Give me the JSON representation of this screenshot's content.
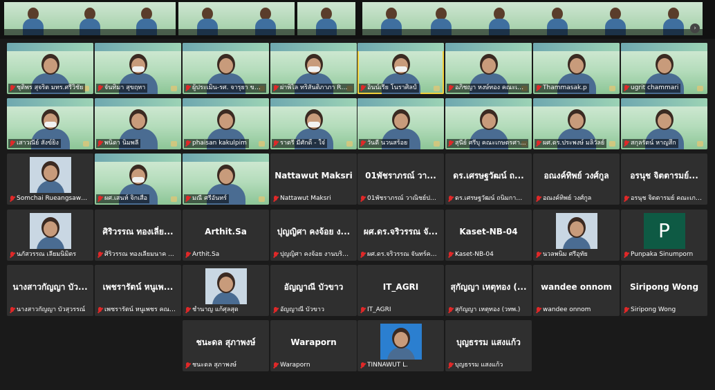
{
  "strip": {
    "thumbs": [
      "",
      "",
      "",
      "",
      "",
      "",
      "",
      "",
      "",
      "",
      "",
      "",
      "",
      "",
      "",
      "",
      "",
      "",
      "",
      "",
      "",
      "",
      "",
      ""
    ],
    "next_icon": "›"
  },
  "tiles": [
    {
      "name": "ชุติพร สุจริต มทร.ศรีวิชัย",
      "video": true,
      "mask": false
    },
    {
      "name": "จันทิมา สุขฤทา",
      "video": true,
      "mask": true
    },
    {
      "name": "ผู้ประเมิน-รศ. จารุยา ขอพลอ...",
      "video": true,
      "mask": false
    },
    {
      "name": "ผ่าพิไล ทริสันติภาภา RUTS",
      "video": true,
      "mask": true
    },
    {
      "name": "อินน์เรีย โนราศิลป์",
      "video": true,
      "mask": true,
      "active": true
    },
    {
      "name": "อภิชญา หงษ์ทอง คณะเก...",
      "video": true,
      "mask": false
    },
    {
      "name": "Thammasak.p",
      "video": true,
      "mask": false
    },
    {
      "name": "ugrit chammari",
      "video": true,
      "mask": false
    },
    {
      "name": "เสาวณีย์ สังข์ยิ่ง",
      "video": true,
      "mask": true
    },
    {
      "name": "พนิดา นิ่มพลี",
      "video": true,
      "mask": false
    },
    {
      "name": "phaisan kakulpim",
      "video": true,
      "mask": false
    },
    {
      "name": "ราตรี มีศักดิ์ - ใจ๋",
      "video": true,
      "mask": true
    },
    {
      "name": "วันดี นวนสร้อย",
      "video": true,
      "mask": false
    },
    {
      "name": "สุนีย์ ศรีบุ คณะเกษตรศา...",
      "video": true,
      "mask": false
    },
    {
      "name": "ผศ.ดร.ประพงษ์ มลิวัลย์",
      "video": true,
      "mask": false
    },
    {
      "name": "สกุลรัตน์ หาญสึก",
      "video": true,
      "mask": false
    },
    {
      "name": "Somchai Rueangsawa...",
      "photo": true
    },
    {
      "name": "ผศ.เสนห์ จิกเสือ",
      "video": true,
      "mask": true
    },
    {
      "name": "มณี ศรีอันทร์",
      "video": true,
      "mask": false
    },
    {
      "name": "Nattawut Maksri",
      "center": "Nattawut Maksri"
    },
    {
      "name": "01พัชราภรณ์ วาณิชย์ปก...",
      "center": "01พัชราภรณ์ วา..."
    },
    {
      "name": "ดร.เศรษฐวัฒน์ ถนิมกาญ...",
      "center": "ดร.เศรษฐวัฒน์ ถ..."
    },
    {
      "name": "อณงค์ทิพย์ วงศ์กูล",
      "center": "อณงค์ทิพย์ วงศ์กูล"
    },
    {
      "name": "อรนุช จิตตารมย์ คณะเกษ...",
      "center": "อรนุช จิตตารมย์..."
    },
    {
      "name": "นภัสวรรณ เลียมนิมิตร",
      "photo": true
    },
    {
      "name": "ศิริวรรณ ทองเลี่ยมนาค ...",
      "center": "ศิริวรรณ ทองเลี่ย..."
    },
    {
      "name": "Arthit.Sa",
      "center": "Arthit.Sa"
    },
    {
      "name": "ปุญญิศา คงจ้อย งานบริก...",
      "center": "ปุญญิศา คงจ้อย ง..."
    },
    {
      "name": "ผศ.ดร.จริวรรณ จันทร์คง ...",
      "center": "ผศ.ดร.จริวรรณ จั..."
    },
    {
      "name": "Kaset-NB-04",
      "center": "Kaset-NB-04"
    },
    {
      "name": "นวลพนิม ศรีอุทัย",
      "photo": true
    },
    {
      "name": "Punpaka Sinumporn",
      "letter": "P"
    },
    {
      "name": "นางสาวกัญญา บัวสุวรรณ์",
      "center": "นางสาวกัญญา บัว..."
    },
    {
      "name": "เพชรารัตน์ หนูเพชร คณะ...",
      "center": "เพชรารัตน์ หนูเพ..."
    },
    {
      "name": "ชำนาญ แก้ศุลสุด",
      "photo": true
    },
    {
      "name": "อัญญาณี บัวขาว",
      "center": "อัญญาณี บัวขาว"
    },
    {
      "name": "IT_AGRI",
      "center": "IT_AGRI"
    },
    {
      "name": "สุกัญญา เหตุทอง (วทพ.)",
      "center": "สุกัญญา เหตุทอง (..."
    },
    {
      "name": "wandee onnom",
      "center": "wandee onnom"
    },
    {
      "name": "Siripong Wong",
      "center": "Siripong Wong"
    },
    {
      "name": "ชนะดล สุภาพงษ์",
      "center": "ชนะดล สุภาพงษ์"
    },
    {
      "name": "Waraporn",
      "center": "Waraporn"
    },
    {
      "name": "TINNAWUT L.",
      "photo": true,
      "blue": true
    },
    {
      "name": "บุญธรรม แสงแก้ว",
      "center": "บุญธรรม แสงแก้ว"
    }
  ],
  "colors": {
    "background": "#1a1a1a",
    "tile": "#2f2f2f",
    "mic_off": "#e02828",
    "active_border": "#f3d13b"
  },
  "icons": {
    "muted": "mic-off-icon",
    "strip_next": "chevron-right-icon"
  }
}
